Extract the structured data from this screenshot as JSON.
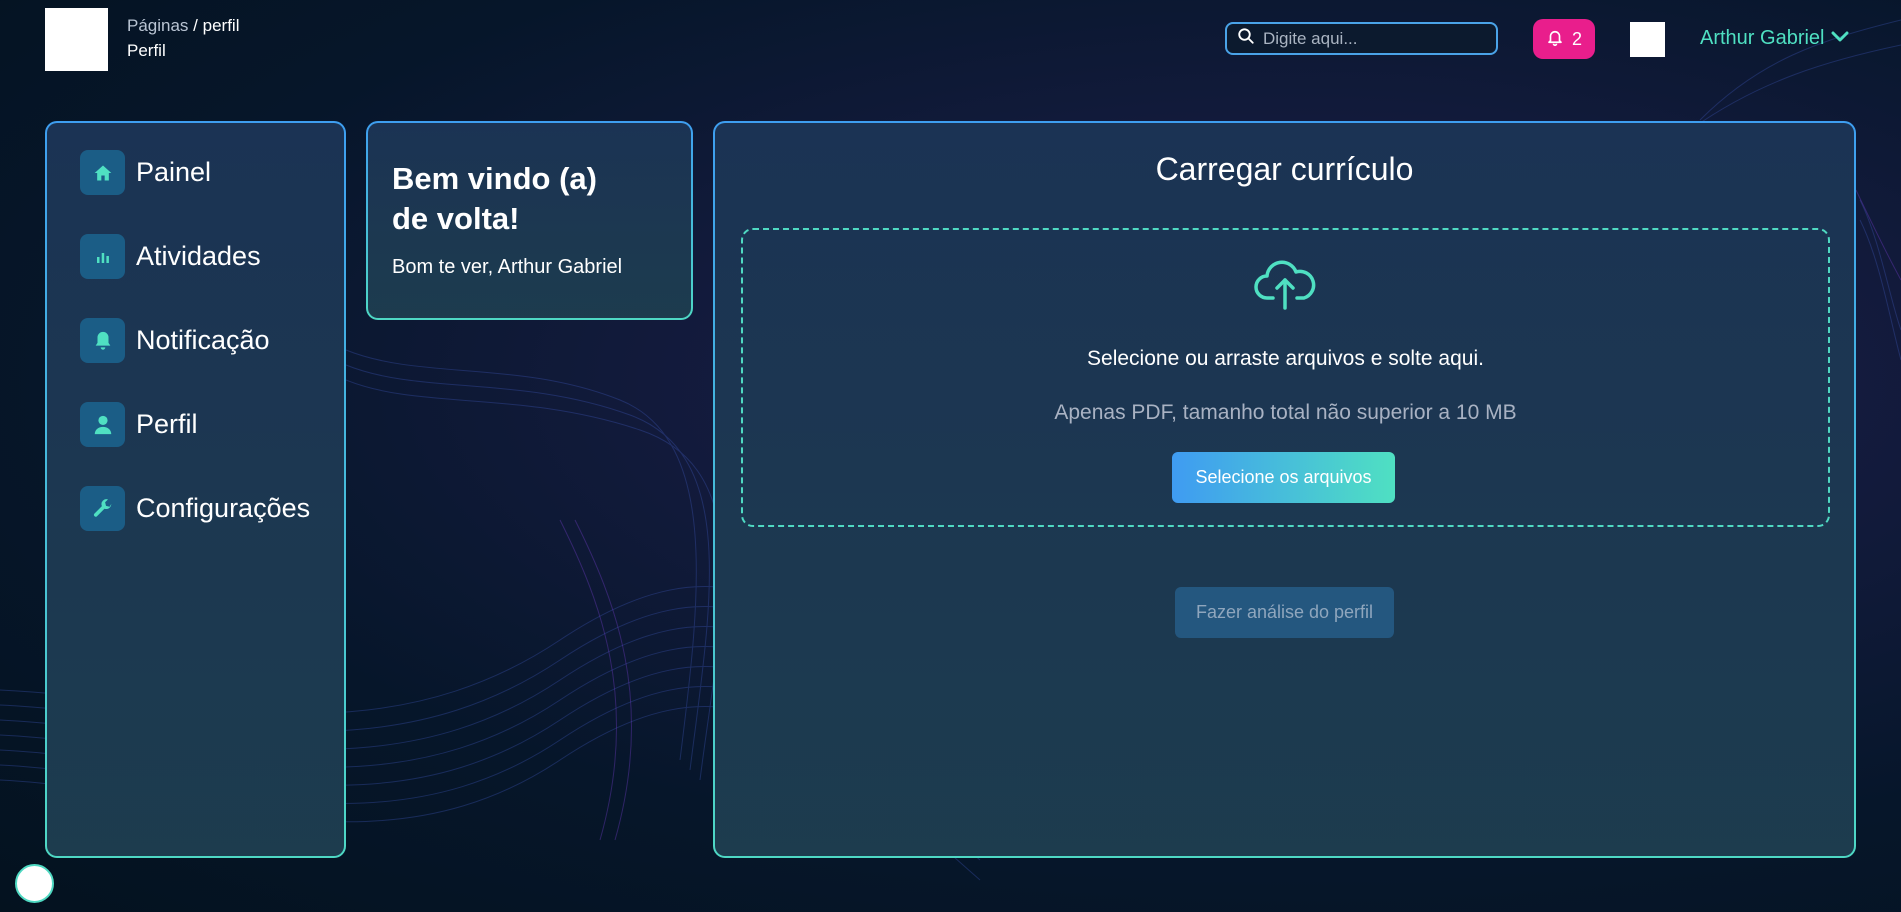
{
  "header": {
    "breadcrumb_root": "Páginas",
    "breadcrumb_separator": "/",
    "breadcrumb_current": "perfil",
    "page_title": "Perfil",
    "search_placeholder": "Digite aqui...",
    "notification_count": "2",
    "user_name": "Arthur Gabriel"
  },
  "sidebar": {
    "items": [
      {
        "label": "Painel",
        "icon": "home-icon"
      },
      {
        "label": "Atividades",
        "icon": "bar-chart-icon"
      },
      {
        "label": "Notificação",
        "icon": "bell-icon"
      },
      {
        "label": "Perfil",
        "icon": "user-icon"
      },
      {
        "label": "Configurações",
        "icon": "wrench-icon"
      }
    ]
  },
  "welcome": {
    "title": "Bem vindo (a) de volta!",
    "subtitle": "Bom te ver, Arthur Gabriel"
  },
  "upload": {
    "title": "Carregar currículo",
    "drop_text": "Selecione ou arraste arquivos e solte aqui.",
    "hint": "Apenas PDF, tamanho total não superior a 10 MB",
    "select_button": "Selecione os arquivos",
    "analyze_button": "Fazer análise do perfil"
  },
  "colors": {
    "accent_teal": "#4fe0c2",
    "accent_blue": "#3f9bf2",
    "notification_pink": "#e91e8c",
    "icon_tile": "#1b5d86"
  }
}
